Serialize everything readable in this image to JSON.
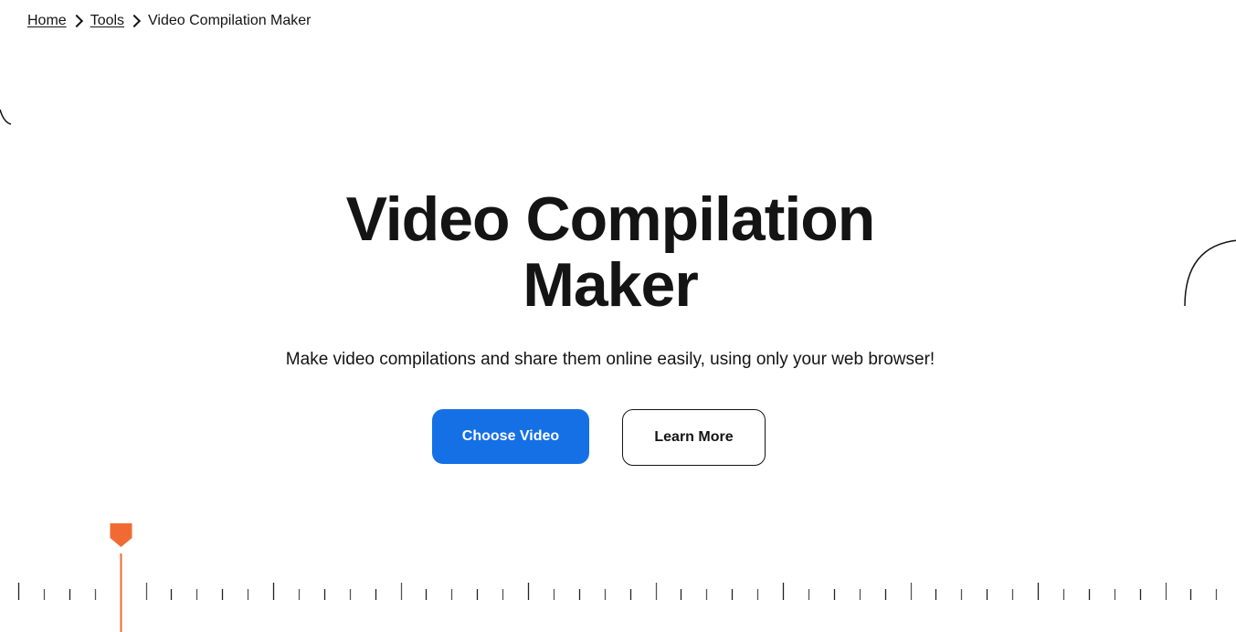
{
  "breadcrumb": {
    "items": [
      {
        "label": "Home",
        "link": true
      },
      {
        "label": "Tools",
        "link": true
      },
      {
        "label": "Video Compilation Maker",
        "link": false
      }
    ]
  },
  "hero": {
    "title_line1": "Video Compilation",
    "title_line2": "Maker",
    "subtitle": "Make video compilations and share them online easily, using only your web browser!",
    "primary_button": "Choose Video",
    "secondary_button": "Learn More"
  },
  "colors": {
    "primary": "#1570e6",
    "playhead": "#f26a33",
    "text": "#141414"
  },
  "timeline": {
    "playhead_position_tick": 4
  }
}
